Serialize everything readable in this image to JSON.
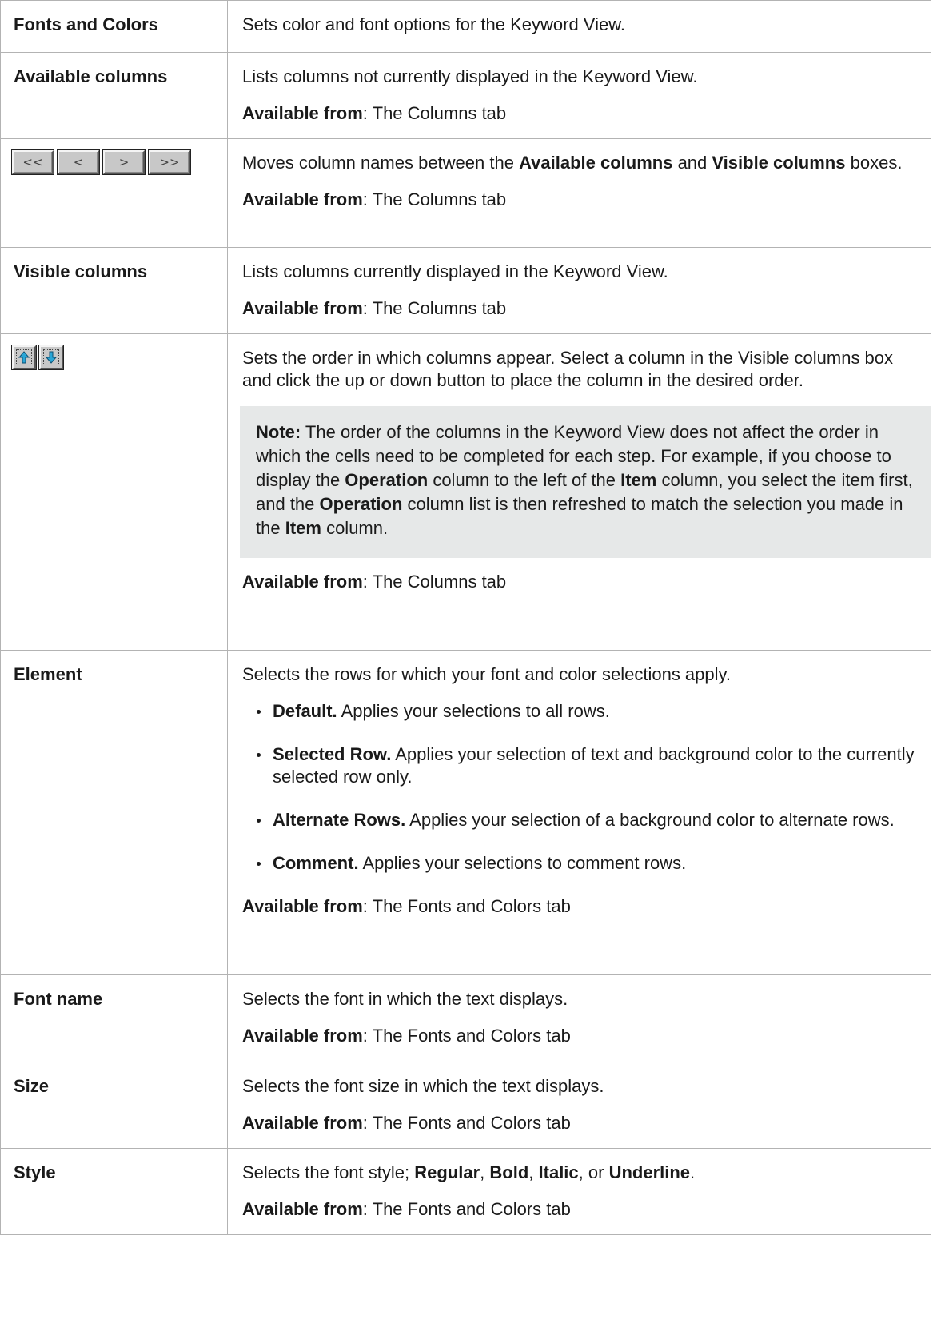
{
  "rows": [
    {
      "label": "Fonts and Colors",
      "description": "Sets color and font options for the Keyword View."
    },
    {
      "label": "Available columns",
      "description": "Lists columns not currently displayed in the Keyword View.",
      "available_label": "Available from",
      "available_value": ": The Columns tab"
    },
    {
      "buttons": [
        "<<",
        "<",
        ">",
        ">>"
      ],
      "description_parts": [
        "Moves column names between the ",
        "Available columns",
        " and ",
        "Visible columns",
        " boxes."
      ],
      "available_label": "Available from",
      "available_value": ": The Columns tab"
    },
    {
      "label": "Visible columns",
      "description": "Lists columns currently displayed in the Keyword View.",
      "available_label": "Available from",
      "available_value": ": The Columns tab"
    },
    {
      "icons": [
        "up-arrow-icon",
        "down-arrow-icon"
      ],
      "description": "Sets the order in which columns appear. Select a column in the Visible columns box and click the up or down button to place the column in the desired order.",
      "note_parts": [
        "Note:",
        " The order of the columns in the Keyword View does not affect the order in which the cells need to be completed for each step. For example, if you choose to display the ",
        "Operation",
        " column to the left of the ",
        "Item",
        " column, you select the item first, and the ",
        "Operation",
        " column list is then refreshed to match the selection you made in the ",
        "Item",
        " column."
      ],
      "available_label": "Available from",
      "available_value": ": The Columns tab"
    },
    {
      "label": "Element",
      "description": "Selects the rows for which your font and color selections apply.",
      "options": [
        {
          "name": "Default.",
          "text": " Applies your selections to all rows."
        },
        {
          "name": "Selected Row.",
          "text": " Applies your selection of text and background color to the currently selected row only."
        },
        {
          "name": "Alternate Rows.",
          "text": " Applies your selection of a background color to alternate rows."
        },
        {
          "name": "Comment.",
          "text": " Applies your selections to comment rows."
        }
      ],
      "available_label": "Available from",
      "available_value": ": The Fonts and Colors tab"
    },
    {
      "label": "Font name",
      "description": "Selects the font in which the text displays.",
      "available_label": "Available from",
      "available_value": ": The Fonts and Colors tab"
    },
    {
      "label": "Size",
      "description": "Selects the font size in which the text displays.",
      "available_label": "Available from",
      "available_value": ": The Fonts and Colors tab"
    },
    {
      "label": "Style",
      "description_parts": [
        "Selects the font style; ",
        "Regular",
        ", ",
        "Bold",
        ", ",
        "Italic",
        ", or ",
        "Underline",
        "."
      ],
      "available_label": "Available from",
      "available_value": ": The Fonts and Colors tab"
    }
  ],
  "colors": {
    "border": "#b3b3b3",
    "note_background": "#e6e8e8",
    "button_face": "#c8c8c8",
    "arrow_icon": "#2aa6d6"
  }
}
